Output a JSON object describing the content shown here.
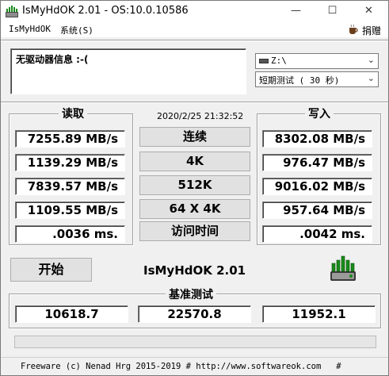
{
  "window": {
    "title": "IsMyHdOK 2.01 - OS:10.0.10586",
    "minimize_glyph": "—",
    "maximize_glyph": "☐",
    "close_glyph": "✕"
  },
  "menu": {
    "items": [
      "IsMyHdOK",
      "系统(S)"
    ],
    "donate_label": "捐赠",
    "donate_icon": "coffee-cup-icon"
  },
  "info": {
    "message": "无驱动器信息 :-("
  },
  "drive_select": {
    "value": "Z:\\",
    "arrow": "⌄"
  },
  "test_select": {
    "value": "短期测试 ( 30 秒)",
    "arrow": "⌄"
  },
  "read": {
    "heading": "读取",
    "values": [
      "7255.89 MB/s",
      "1139.29 MB/s",
      "7839.57 MB/s",
      "1109.55 MB/s",
      ".0036 ms."
    ]
  },
  "write": {
    "heading": "写入",
    "values": [
      "8302.08 MB/s",
      "976.47 MB/s",
      "9016.02 MB/s",
      "957.64 MB/s",
      ".0042 ms."
    ]
  },
  "timestamp": "2020/2/25 21:32:52",
  "modes": [
    "连续",
    "4K",
    "512K",
    "64 X 4K",
    "访问时间"
  ],
  "start_button": "开始",
  "app_name": "IsMyHdOK 2.01",
  "benchmark": {
    "heading": "基准测试",
    "read_score": "10618.7",
    "total_score": "22570.8",
    "write_score": "11952.1"
  },
  "progress": {
    "fraction": 0.0,
    "color": "#06b025"
  },
  "status": "Freeware (c) Nenad Hrg 2015-2019 # http://www.softwareok.com   #"
}
